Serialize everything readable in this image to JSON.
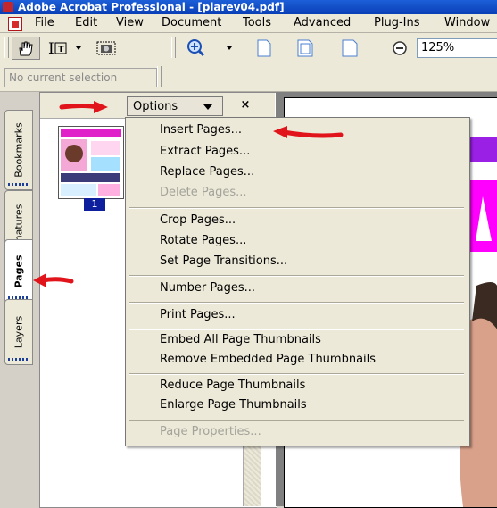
{
  "window": {
    "title": "Adobe Acrobat Professional - [plarev04.pdf]"
  },
  "menubar": {
    "items": [
      "File",
      "Edit",
      "View",
      "Document",
      "Tools",
      "Advanced",
      "Plug-Ins",
      "Window"
    ]
  },
  "toolbar": {
    "zoom_value": "125%",
    "selection_text": "No current selection"
  },
  "side_tabs": [
    "Bookmarks",
    "Signatures",
    "Pages",
    "Layers"
  ],
  "panel": {
    "options_label": "Options",
    "close_glyph": "×",
    "page_number": "1"
  },
  "dropdown": {
    "groups": [
      [
        {
          "label": "Insert Pages...",
          "enabled": true
        },
        {
          "label": "Extract Pages...",
          "enabled": true
        },
        {
          "label": "Replace Pages...",
          "enabled": true
        },
        {
          "label": "Delete Pages...",
          "enabled": false
        }
      ],
      [
        {
          "label": "Crop Pages...",
          "enabled": true
        },
        {
          "label": "Rotate Pages...",
          "enabled": true
        },
        {
          "label": "Set Page Transitions...",
          "enabled": true
        }
      ],
      [
        {
          "label": "Number Pages...",
          "enabled": true
        }
      ],
      [
        {
          "label": "Print Pages...",
          "enabled": true
        }
      ],
      [
        {
          "label": "Embed All Page Thumbnails",
          "enabled": true
        },
        {
          "label": "Remove Embedded Page Thumbnails",
          "enabled": true
        }
      ],
      [
        {
          "label": "Reduce Page Thumbnails",
          "enabled": true
        },
        {
          "label": "Enlarge Page Thumbnails",
          "enabled": true
        }
      ],
      [
        {
          "label": "Page Properties...",
          "enabled": false
        }
      ]
    ]
  },
  "colors": {
    "titlebar": "#0a3fb6",
    "annotation_arrow": "#e0141a",
    "page_banner": "#9b20e6",
    "page_banner_2": "#ff00ff"
  }
}
